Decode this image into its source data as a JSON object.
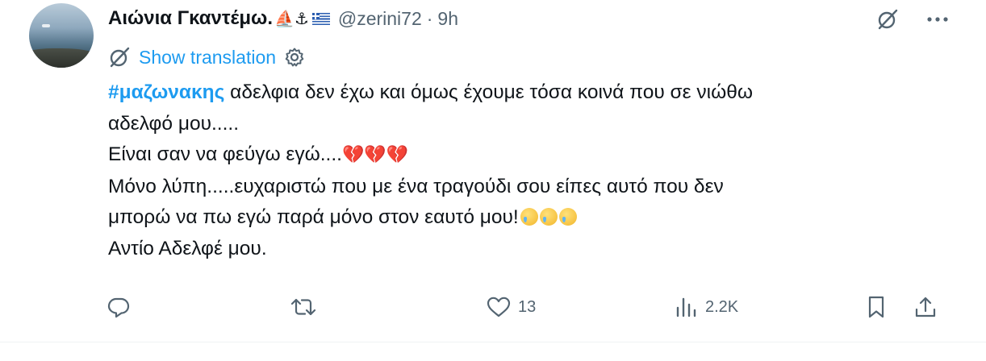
{
  "tweet": {
    "author": {
      "name": "Αιώνια Γκαντέμω.",
      "name_emojis": "⛵⚓",
      "flag": "greece-flag",
      "handle": "@zerini72",
      "separator": "·",
      "time": "9h"
    },
    "translation": {
      "label": "Show translation"
    },
    "text": {
      "hashtag": "#μαζωνακης",
      "line1_rest": " αδελφια δεν έχω και όμως έχουμε τόσα κοινά που σε νιώθω",
      "line2": "αδελφό μου.....",
      "line3": "Είναι σαν να φεύγω εγώ....",
      "line3_emoji": "💔💔💔",
      "line4": "Μόνο λύπη.....ευχαριστώ που με ένα τραγούδι σου είπες αυτό που δεν",
      "line5": "μπορώ να πω εγώ παρά μόνο στον εαυτό μου!",
      "line5_emoji": "crying-face-emoji x3",
      "line6": "Αντίο Αδελφέ μου."
    },
    "actions": {
      "reply_count": "",
      "retweet_count": "",
      "like_count": "13",
      "views_count": "2.2K"
    },
    "icons": {
      "grok": "grok-icon",
      "more": "more-icon",
      "translate": "translate-icon",
      "settings": "gear-icon",
      "reply": "reply-icon",
      "retweet": "retweet-icon",
      "like": "heart-icon",
      "views": "views-icon",
      "bookmark": "bookmark-icon",
      "share": "share-icon"
    },
    "colors": {
      "accent": "#1d9bf0",
      "text": "#0f1419",
      "muted": "#536471",
      "divider": "#eff3f4"
    }
  }
}
